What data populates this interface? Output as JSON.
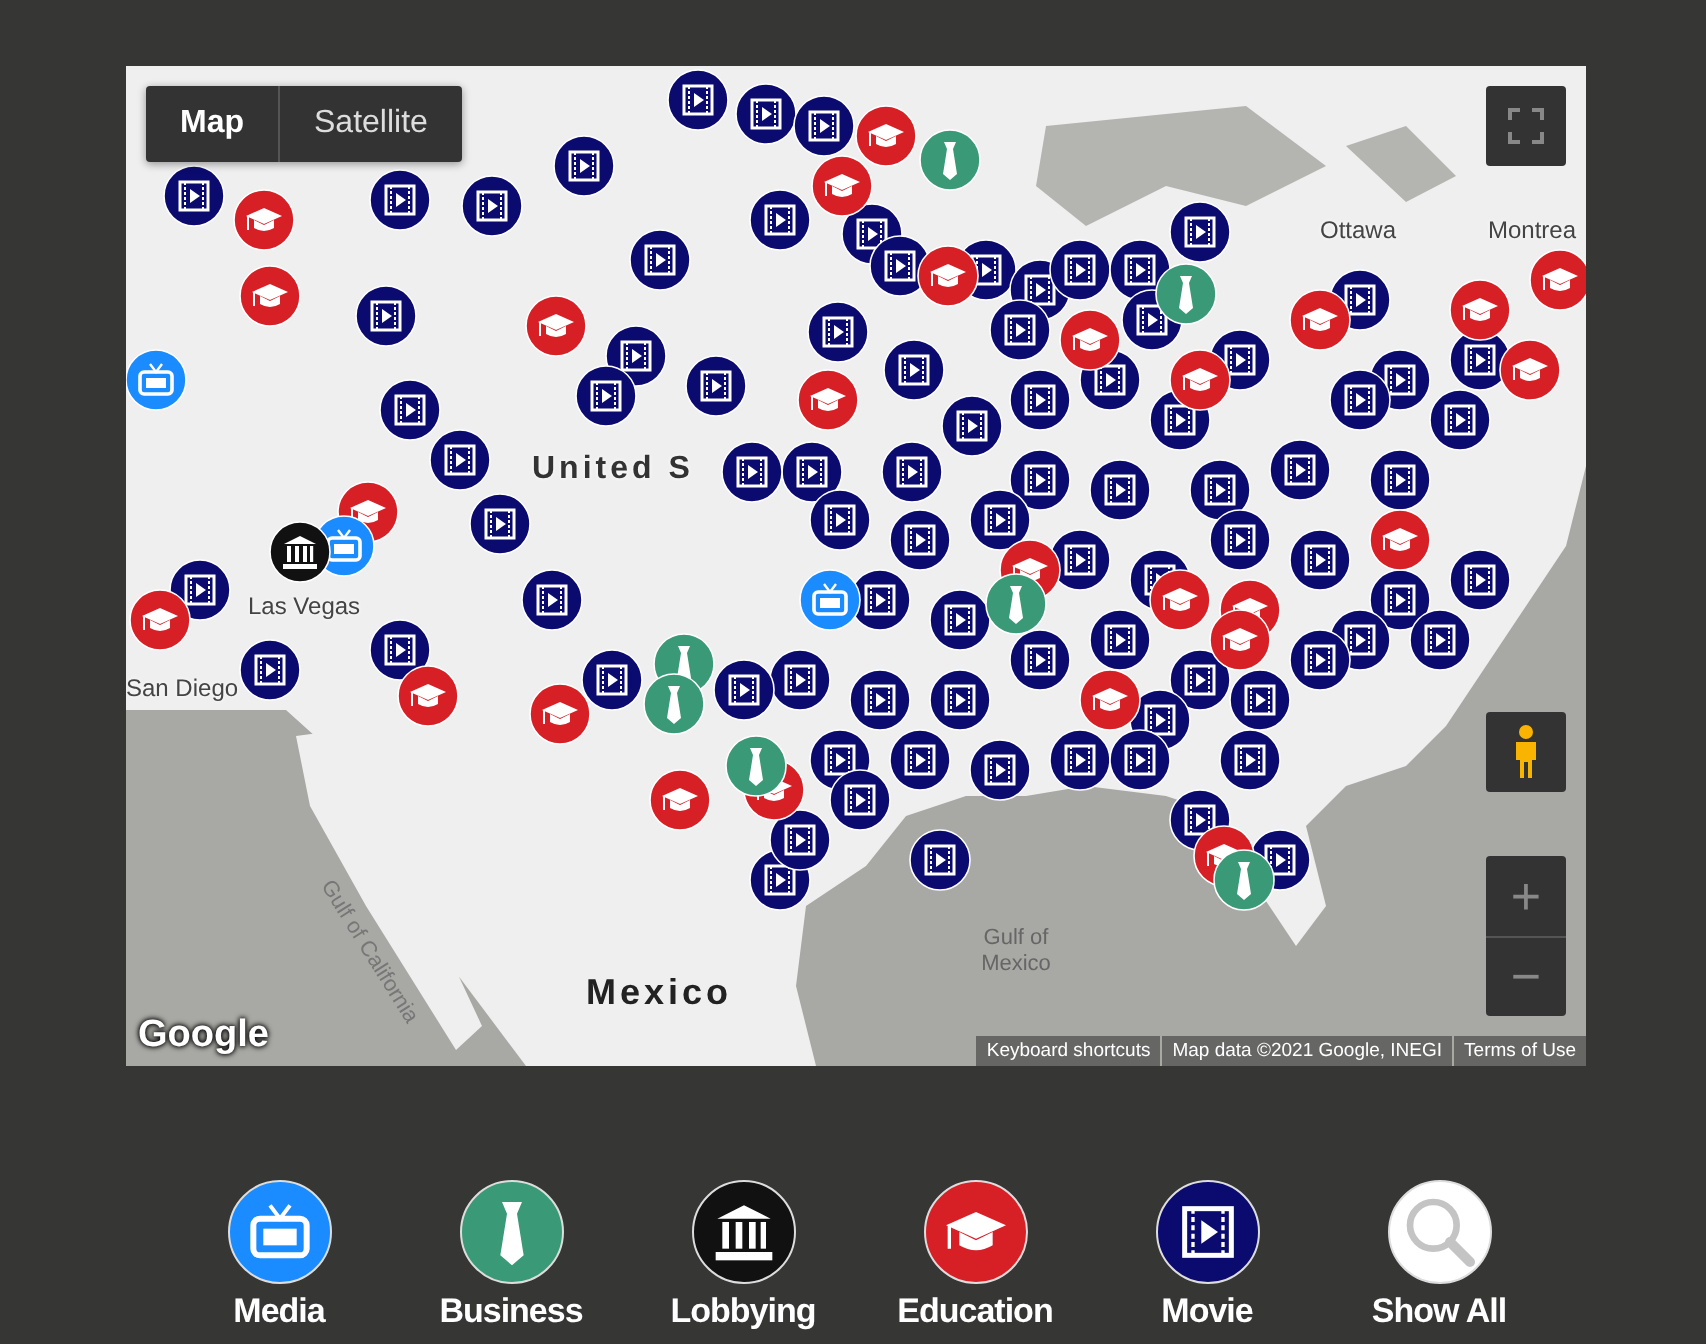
{
  "map": {
    "map_type": [
      {
        "label": "Map",
        "selected": true
      },
      {
        "label": "Satellite",
        "selected": false
      }
    ],
    "labels": [
      {
        "text": "Ottawa"
      },
      {
        "text": "Montrea"
      },
      {
        "text": "United S"
      },
      {
        "text": "Las Vegas"
      },
      {
        "text": "San Diego"
      },
      {
        "text": "Gulf of California"
      },
      {
        "text": "Mexico"
      },
      {
        "text": "Gulf of Mexico"
      }
    ],
    "markers": [
      {
        "kind": "movie"
      },
      {
        "kind": "movie"
      },
      {
        "kind": "movie"
      },
      {
        "kind": "movie"
      },
      {
        "kind": "movie"
      },
      {
        "kind": "movie"
      },
      {
        "kind": "movie"
      },
      {
        "kind": "movie"
      },
      {
        "kind": "movie"
      },
      {
        "kind": "movie"
      },
      {
        "kind": "movie"
      },
      {
        "kind": "movie"
      },
      {
        "kind": "movie"
      },
      {
        "kind": "movie"
      },
      {
        "kind": "movie"
      },
      {
        "kind": "movie"
      },
      {
        "kind": "movie"
      },
      {
        "kind": "movie"
      },
      {
        "kind": "movie"
      },
      {
        "kind": "movie"
      },
      {
        "kind": "movie"
      },
      {
        "kind": "movie"
      },
      {
        "kind": "movie"
      },
      {
        "kind": "movie"
      },
      {
        "kind": "movie"
      },
      {
        "kind": "movie"
      },
      {
        "kind": "movie"
      },
      {
        "kind": "movie"
      },
      {
        "kind": "movie"
      },
      {
        "kind": "movie"
      },
      {
        "kind": "movie"
      },
      {
        "kind": "movie"
      },
      {
        "kind": "movie"
      },
      {
        "kind": "movie"
      },
      {
        "kind": "movie"
      },
      {
        "kind": "movie"
      },
      {
        "kind": "movie"
      },
      {
        "kind": "movie"
      },
      {
        "kind": "movie"
      },
      {
        "kind": "movie"
      },
      {
        "kind": "movie"
      },
      {
        "kind": "movie"
      },
      {
        "kind": "movie"
      },
      {
        "kind": "movie"
      },
      {
        "kind": "movie"
      },
      {
        "kind": "movie"
      },
      {
        "kind": "movie"
      },
      {
        "kind": "movie"
      },
      {
        "kind": "movie"
      },
      {
        "kind": "movie"
      },
      {
        "kind": "movie"
      },
      {
        "kind": "movie"
      },
      {
        "kind": "movie"
      },
      {
        "kind": "movie"
      },
      {
        "kind": "movie"
      },
      {
        "kind": "movie"
      },
      {
        "kind": "movie"
      },
      {
        "kind": "movie"
      },
      {
        "kind": "movie"
      },
      {
        "kind": "movie"
      },
      {
        "kind": "movie"
      },
      {
        "kind": "movie"
      },
      {
        "kind": "movie"
      },
      {
        "kind": "movie"
      },
      {
        "kind": "movie"
      },
      {
        "kind": "movie"
      },
      {
        "kind": "movie"
      },
      {
        "kind": "movie"
      },
      {
        "kind": "movie"
      },
      {
        "kind": "movie"
      },
      {
        "kind": "movie"
      },
      {
        "kind": "movie"
      },
      {
        "kind": "movie"
      },
      {
        "kind": "movie"
      },
      {
        "kind": "movie"
      },
      {
        "kind": "movie"
      },
      {
        "kind": "movie"
      },
      {
        "kind": "movie"
      },
      {
        "kind": "movie"
      },
      {
        "kind": "movie"
      },
      {
        "kind": "movie"
      },
      {
        "kind": "movie"
      },
      {
        "kind": "movie"
      },
      {
        "kind": "movie"
      },
      {
        "kind": "movie"
      },
      {
        "kind": "education"
      },
      {
        "kind": "education"
      },
      {
        "kind": "education"
      },
      {
        "kind": "education"
      },
      {
        "kind": "education"
      },
      {
        "kind": "education"
      },
      {
        "kind": "education"
      },
      {
        "kind": "education"
      },
      {
        "kind": "education"
      },
      {
        "kind": "education"
      },
      {
        "kind": "education"
      },
      {
        "kind": "education"
      },
      {
        "kind": "education"
      },
      {
        "kind": "education"
      },
      {
        "kind": "education"
      },
      {
        "kind": "education"
      },
      {
        "kind": "education"
      },
      {
        "kind": "education"
      },
      {
        "kind": "education"
      },
      {
        "kind": "education"
      },
      {
        "kind": "education"
      },
      {
        "kind": "education"
      },
      {
        "kind": "education"
      },
      {
        "kind": "education"
      },
      {
        "kind": "education"
      },
      {
        "kind": "education"
      },
      {
        "kind": "business"
      },
      {
        "kind": "business"
      },
      {
        "kind": "business"
      },
      {
        "kind": "business"
      },
      {
        "kind": "business"
      },
      {
        "kind": "business"
      },
      {
        "kind": "business"
      },
      {
        "kind": "media"
      },
      {
        "kind": "media"
      },
      {
        "kind": "media"
      },
      {
        "kind": "lobbying"
      }
    ],
    "zoom_in": "+",
    "zoom_out": "−",
    "logo": "Google",
    "attribution": [
      {
        "text": "Keyboard shortcuts"
      },
      {
        "text": "Map data ©2021 Google, INEGI"
      },
      {
        "text": "Terms of Use"
      }
    ]
  },
  "legend": [
    {
      "kind": "media",
      "label": "Media"
    },
    {
      "kind": "business",
      "label": "Business"
    },
    {
      "kind": "lobbying",
      "label": "Lobbying"
    },
    {
      "kind": "education",
      "label": "Education"
    },
    {
      "kind": "movie",
      "label": "Movie"
    },
    {
      "kind": "show_all",
      "label": "Show All"
    }
  ]
}
